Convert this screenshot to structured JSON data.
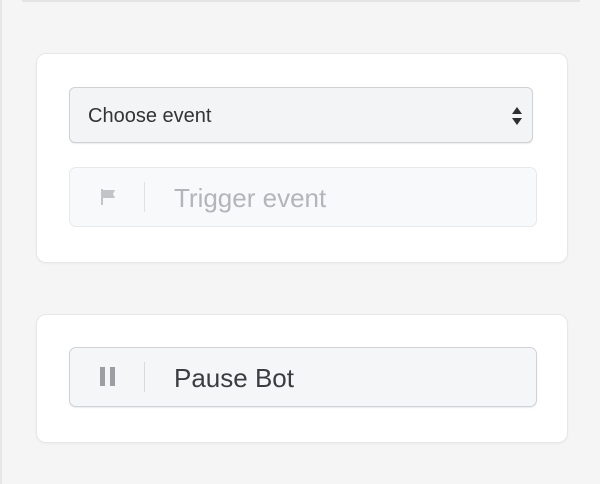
{
  "event_card": {
    "select": {
      "selected_label": "Choose event",
      "icon": "up-down-arrows-icon"
    },
    "trigger": {
      "label": "Trigger event",
      "icon": "flag-icon",
      "state": "disabled"
    }
  },
  "pause_card": {
    "label": "Pause Bot",
    "icon": "pause-icon"
  },
  "colors": {
    "page_background": "#f5f5f5",
    "card_background": "#ffffff",
    "disabled_text": "#b3b5b9",
    "primary_text": "#3b3d40"
  }
}
